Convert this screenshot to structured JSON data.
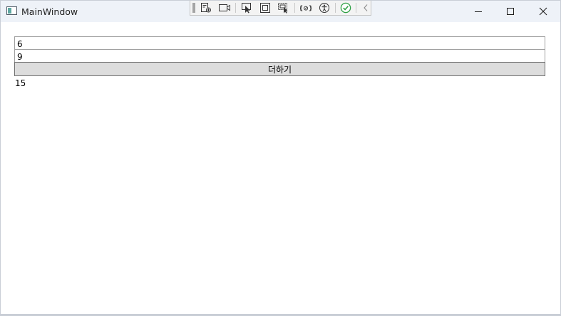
{
  "window": {
    "title": "MainWindow",
    "icon": "window-app-icon"
  },
  "debug_toolbar": {
    "buttons": [
      {
        "name": "live-visual-tree-icon"
      },
      {
        "name": "record-icon"
      },
      {
        "name": "select-element-icon"
      },
      {
        "name": "display-layout-adorners-icon"
      },
      {
        "name": "track-focused-element-icon"
      },
      {
        "name": "binding-failures-icon"
      },
      {
        "name": "accessibility-icon"
      },
      {
        "name": "hot-reload-ok-icon"
      },
      {
        "name": "collapse-toolbar-icon"
      }
    ]
  },
  "caption_buttons": [
    "minimize-icon",
    "maximize-icon",
    "close-icon"
  ],
  "form": {
    "first_value": "6",
    "second_value": "9",
    "add_button_label": "더하기",
    "result": "15"
  },
  "colors": {
    "titlebar": "#eef2f8",
    "button_face": "#dddddd",
    "hot_reload_ok": "#2ea043"
  }
}
